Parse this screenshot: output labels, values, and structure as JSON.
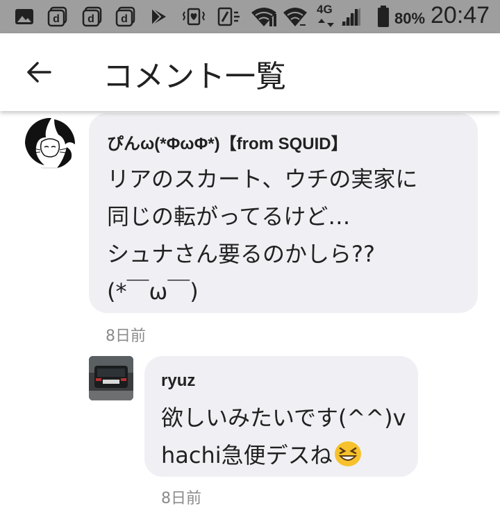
{
  "status_bar": {
    "network_label": "4G",
    "battery_percent": "80%",
    "time": "20:47",
    "icons": [
      "image-icon",
      "docomo-d-icon",
      "docomo-d-icon",
      "docomo-d-icon",
      "play-store-icon",
      "vibrate-heart-icon",
      "nfc-icon",
      "wifi-icon",
      "wifi-icon",
      "signal-icon",
      "battery-icon"
    ]
  },
  "app_bar": {
    "back_icon": "arrow-back-icon",
    "title": "コメント一覧"
  },
  "comments": [
    {
      "author": "ぴんω(*ΦωΦ*)【from SQUID】",
      "lines": [
        "リアのスカート、ウチの実家に",
        "同じの転がってるけど…",
        "シュナさん要るのかしら??",
        "(*￣ω￣)"
      ],
      "timestamp": "8日前",
      "avatar": "cat-avatar"
    },
    {
      "author": "ryuz",
      "lines": [
        "欲しいみたいです(^^)v",
        "hachi急便デスね"
      ],
      "emoji": "😆",
      "timestamp": "8日前",
      "avatar": "car-photo-avatar"
    }
  ],
  "colors": {
    "status_bar_bg": "#9e9e9e",
    "bubble_bg": "#f0f0f4",
    "text": "#212121",
    "timestamp": "#8a8a8a"
  }
}
